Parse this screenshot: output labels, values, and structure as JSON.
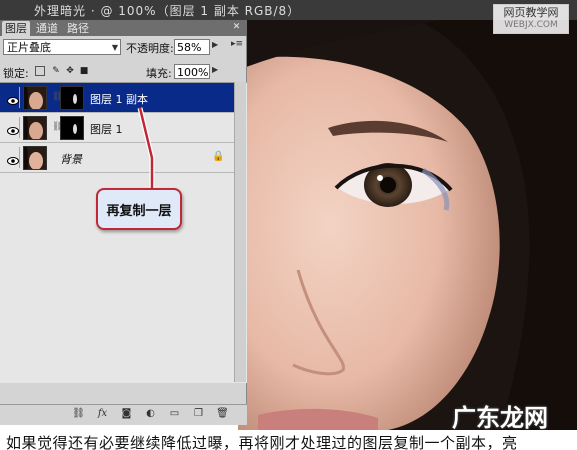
{
  "document": {
    "title_partial": "外理暗光 · @ 100%（图层 1 副本 RGB/8）"
  },
  "site_watermark": {
    "line1": "网页教学网",
    "line2": "WEBJX.COM"
  },
  "panel": {
    "tabs": [
      "图层",
      "通道",
      "路径"
    ],
    "blend_mode": "正片叠底",
    "opacity_label": "不透明度:",
    "opacity_value": "58%",
    "lock_label": "锁定:",
    "fill_label": "填充:",
    "fill_value": "100%",
    "layers": [
      {
        "name": "图层 1 副本",
        "selected": true,
        "has_mask": true
      },
      {
        "name": "图层 1",
        "selected": false,
        "has_mask": true
      },
      {
        "name": "背景",
        "selected": false,
        "has_mask": false,
        "locked": true
      }
    ]
  },
  "annotation": {
    "text": "再复制一层"
  },
  "caption": {
    "text": "如果觉得还有必要继续降低过曝，再将刚才处理过的图层复制一个副本，亮"
  },
  "corner_watermark": {
    "text": "广东龙网"
  },
  "colors": {
    "selected_layer": "#0a2a8a",
    "callout_border": "#c02838",
    "callout_fill": "#dfe9f7"
  }
}
